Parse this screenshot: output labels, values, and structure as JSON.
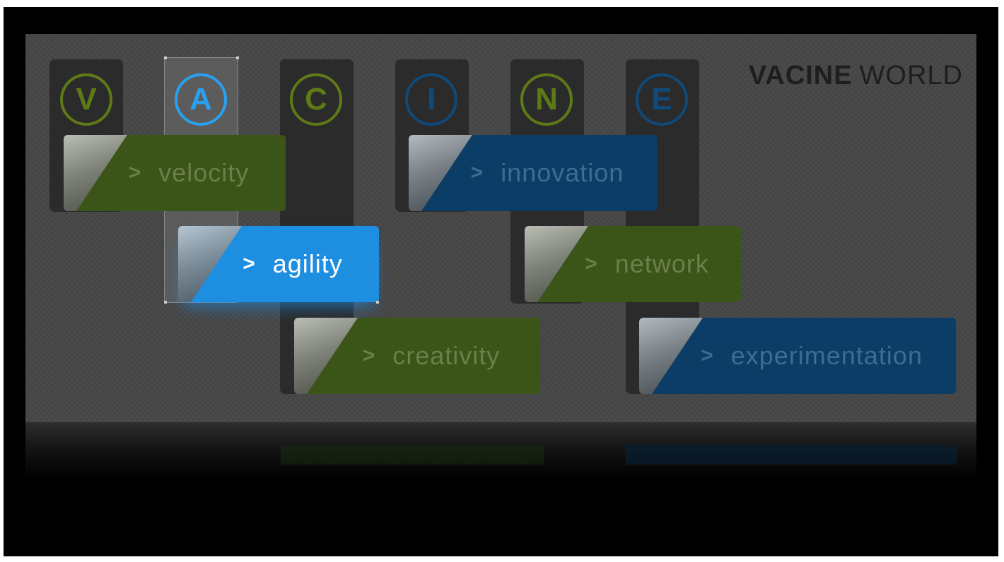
{
  "brand": {
    "bold": "VACINE",
    "light": "WORLD"
  },
  "letters": [
    {
      "key": "v",
      "letter": "V",
      "color": "green",
      "active": false
    },
    {
      "key": "a",
      "letter": "A",
      "color": "blue",
      "active": true
    },
    {
      "key": "c",
      "letter": "C",
      "color": "green",
      "active": false
    },
    {
      "key": "i",
      "letter": "I",
      "color": "blue",
      "active": false
    },
    {
      "key": "n",
      "letter": "N",
      "color": "green",
      "active": false
    },
    {
      "key": "e",
      "letter": "E",
      "color": "blue",
      "active": false
    }
  ],
  "tags": [
    {
      "key": "velocity",
      "chevron": ">",
      "label": "velocity",
      "color": "green",
      "active": false
    },
    {
      "key": "agility",
      "chevron": ">",
      "label": "agility",
      "color": "blue",
      "active": true
    },
    {
      "key": "creativity",
      "chevron": ">",
      "label": "creativity",
      "color": "green",
      "active": false
    },
    {
      "key": "innovation",
      "chevron": ">",
      "label": "innovation",
      "color": "blue",
      "active": false
    },
    {
      "key": "network",
      "chevron": ">",
      "label": "network",
      "color": "green",
      "active": false
    },
    {
      "key": "experimentation",
      "chevron": ">",
      "label": "experimentation",
      "color": "blue",
      "active": false
    }
  ],
  "colors": {
    "green": "#3b5418",
    "blue": "#0b3d66",
    "active": "#1e8ee0",
    "badge_green": "#5e7a16",
    "badge_blue": "#0f4a7a",
    "badge_active": "#2aa0f0"
  }
}
